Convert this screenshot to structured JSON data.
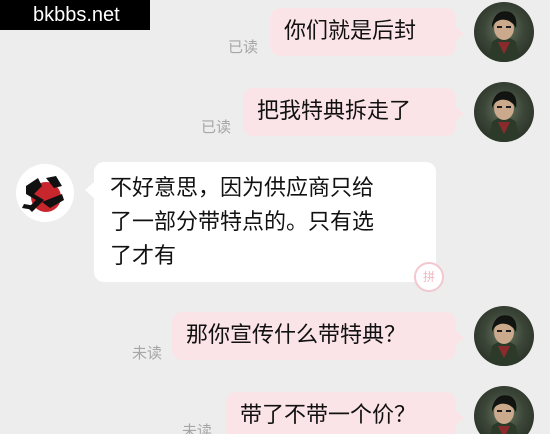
{
  "watermark": {
    "text": "bkbbs.net"
  },
  "messages": [
    {
      "text": "你们就是后封",
      "status": "已读"
    },
    {
      "text": "把我特典拆走了",
      "status": "已读"
    },
    {
      "lines": [
        "不好意思，因为供应商只给",
        "了一部分带特点的。只有选",
        "了才有"
      ]
    },
    {
      "text": "那你宣传什么带特典？",
      "status": "未读"
    },
    {
      "text": "带了不带一个价？",
      "status": "未读"
    }
  ],
  "shop_avatar": {
    "logo_lettering": "大"
  },
  "stamp_text": "拼",
  "colors": {
    "background": "#ededed",
    "outgoing_bubble": "#fbe4e8",
    "incoming_bubble": "#ffffff",
    "status_text": "#a6a6a6"
  }
}
